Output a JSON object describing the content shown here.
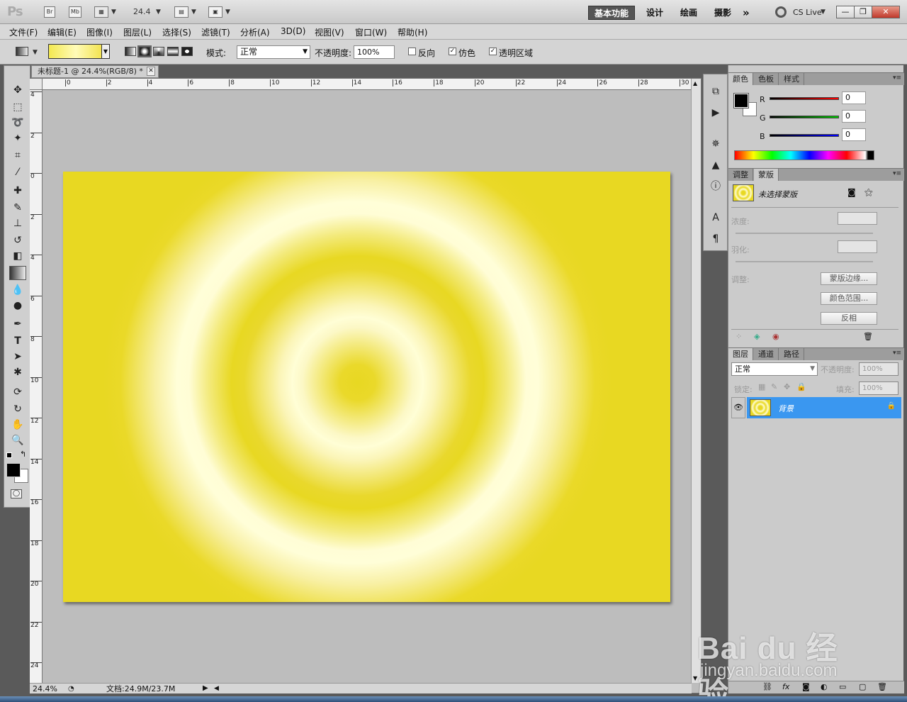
{
  "appbar": {
    "logo": "Ps",
    "br": "Br",
    "mb": "Mb",
    "zoom": "24.4",
    "workspaces": [
      "基本功能",
      "设计",
      "绘画",
      "摄影"
    ],
    "more": "»",
    "cslive": "CS Live",
    "window_min": "—",
    "window_restore": "❐",
    "window_close": "✕"
  },
  "menu": [
    "文件(F)",
    "编辑(E)",
    "图像(I)",
    "图层(L)",
    "选择(S)",
    "滤镜(T)",
    "分析(A)",
    "3D(D)",
    "视图(V)",
    "窗口(W)",
    "帮助(H)"
  ],
  "options": {
    "mode_label": "模式:",
    "mode_value": "正常",
    "opacity_label": "不透明度:",
    "opacity_value": "100%",
    "reverse_label": "反向",
    "dither_label": "仿色",
    "transparency_label": "透明区域",
    "reverse_checked": false,
    "dither_checked": true,
    "transparency_checked": true
  },
  "document": {
    "tab_title": "未标题-1 @ 24.4%(RGB/8) *",
    "ruler_top": [
      "0",
      "2",
      "4",
      "6",
      "8",
      "10",
      "12",
      "14",
      "16",
      "18",
      "20",
      "22",
      "24",
      "26",
      "28",
      "30"
    ],
    "ruler_left": [
      "4",
      "2",
      "0",
      "2",
      "4",
      "6",
      "8",
      "10",
      "12",
      "14",
      "16",
      "18",
      "20",
      "22",
      "24"
    ],
    "zoom_status": "24.4%",
    "doc_status": "文档:24.9M/23.7M",
    "colors": {
      "primary": "#e8d822",
      "light": "#fffed8"
    }
  },
  "color_panel": {
    "tabs": [
      "颜色",
      "色板",
      "样式"
    ],
    "channels": [
      {
        "label": "R",
        "value": "0"
      },
      {
        "label": "G",
        "value": "0"
      },
      {
        "label": "B",
        "value": "0"
      }
    ]
  },
  "mask_panel": {
    "tabs": [
      "调整",
      "蒙版"
    ],
    "title": "未选择蒙版",
    "density_label": "浓度:",
    "feather_label": "羽化:",
    "refine_label": "调整:",
    "btn_edge": "蒙版边缘...",
    "btn_range": "颜色范围...",
    "btn_invert": "反相"
  },
  "layers_panel": {
    "tabs": [
      "图层",
      "通道",
      "路径"
    ],
    "blend_mode": "正常",
    "opacity_label": "不透明度:",
    "opacity_value": "100%",
    "lock_label": "锁定:",
    "fill_label": "填充:",
    "fill_value": "100%",
    "layers": [
      {
        "name": "背景",
        "visible": true,
        "locked": true
      }
    ]
  },
  "watermark": {
    "brand": "Bai du 经验",
    "url": "jingyan.baidu.com"
  }
}
